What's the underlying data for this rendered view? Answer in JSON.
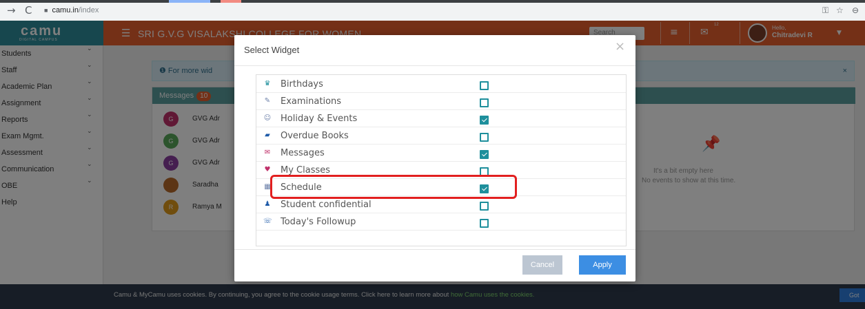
{
  "browser": {
    "back_icon": "→",
    "reload_icon": "C",
    "lock_icon": "lock-icon",
    "url_host": "camu.in",
    "url_path": "/index",
    "key_icon": "key-icon",
    "star_icon": "star-icon",
    "profile_icon": "profile-icon"
  },
  "app": {
    "logo": "camu",
    "logo_sub": "DIGITAL CAMPUS",
    "college_name": "SRI G.V.G VISALAKSHI COLLEGE FOR WOMEN",
    "search_placeholder": "Search",
    "mail_badge": "12",
    "user_greeting": "Hello,",
    "user_name": "Chitradevi R",
    "colors": {
      "header": "#e9612f",
      "logo_bg": "#2f8f9d",
      "accent": "#1e8f9c",
      "apply": "#3c8ee3"
    }
  },
  "sidebar": {
    "items": [
      {
        "label": "Students",
        "has_chevron": true
      },
      {
        "label": "Staff",
        "has_chevron": true
      },
      {
        "label": "Academic Plan",
        "has_chevron": true
      },
      {
        "label": "Assignment",
        "has_chevron": true
      },
      {
        "label": "Reports",
        "has_chevron": true
      },
      {
        "label": "Exam Mgmt.",
        "has_chevron": true
      },
      {
        "label": "Assessment",
        "has_chevron": true
      },
      {
        "label": "Communication",
        "has_chevron": true
      },
      {
        "label": "OBE",
        "has_chevron": true
      },
      {
        "label": "Help",
        "has_chevron": false
      }
    ]
  },
  "content": {
    "info_text": "For more wid",
    "messages_title": "Messages",
    "messages_count": "10",
    "messages": [
      {
        "initial": "G",
        "sender": "GVG Adr",
        "color": "#c0306a"
      },
      {
        "initial": "G",
        "sender": "GVG Adr",
        "color": "#58a85a"
      },
      {
        "initial": "G",
        "sender": "GVG Adr",
        "color": "#8a3fa0"
      },
      {
        "initial": "",
        "sender": "Saradha",
        "color": "#b86a2a"
      },
      {
        "initial": "R",
        "sender": "Ramya M",
        "color": "#e09a1a"
      }
    ],
    "empty_line1": "It's a bit empty here",
    "empty_line2": "No events to show at this time."
  },
  "cookie": {
    "text": "Camu & MyCamu uses cookies. By continuing, you agree to the cookie usage terms. Click here to learn more about ",
    "link": "how Camu uses the cookies.",
    "button": "Got"
  },
  "modal": {
    "title": "Select Widget",
    "close_icon": "×",
    "widgets": [
      {
        "label": "Birthdays",
        "icon": "birthday-cake-icon",
        "glyph": "♛",
        "checked": false
      },
      {
        "label": "Examinations",
        "icon": "edit-icon",
        "glyph": "✎",
        "checked": false
      },
      {
        "label": "Holiday & Events",
        "icon": "smile-icon",
        "glyph": "☺",
        "checked": true
      },
      {
        "label": "Overdue Books",
        "icon": "book-icon",
        "glyph": "▰",
        "checked": false
      },
      {
        "label": "Messages",
        "icon": "envelope-icon",
        "glyph": "✉",
        "checked": true
      },
      {
        "label": "My Classes",
        "icon": "classroom-icon",
        "glyph": "♥",
        "checked": false
      },
      {
        "label": "Schedule",
        "icon": "calendar-icon",
        "glyph": "▦",
        "checked": true
      },
      {
        "label": "Student confidential",
        "icon": "user-icon",
        "glyph": "♟",
        "checked": false
      },
      {
        "label": "Today's Followup",
        "icon": "phone-icon",
        "glyph": "☏",
        "checked": false
      }
    ],
    "cancel_label": "Cancel",
    "apply_label": "Apply"
  }
}
